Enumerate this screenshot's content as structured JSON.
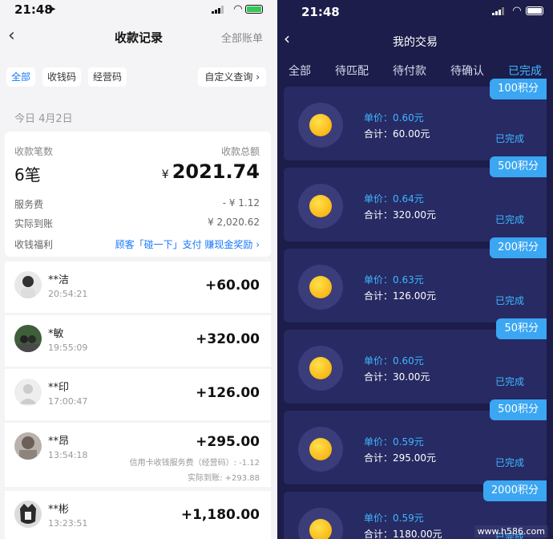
{
  "left": {
    "status": {
      "time": "21:48"
    },
    "nav": {
      "back": "‹",
      "title": "收款记录",
      "all_bills": "全部账单"
    },
    "filters": {
      "all": "全部",
      "qr_money": "收钱码",
      "business_code": "经营码",
      "custom": "自定义查询 ›"
    },
    "date": "今日 4月2日",
    "summary": {
      "count_label": "收款笔数",
      "total_label": "收款总额",
      "count_value": "6笔",
      "currency": "¥",
      "total_value": "2021.74",
      "service_fee_label": "服务费",
      "service_fee_value": "- ¥ 1.12",
      "actual_label": "实际到账",
      "actual_value": "¥ 2,020.62",
      "benefit_label": "收钱福利",
      "benefit_link": "顾客「碰一下」支付 赚现金奖励 ›"
    },
    "transactions": [
      {
        "name": "**洁",
        "time": "20:54:21",
        "amount": "+60.00"
      },
      {
        "name": "*敏",
        "time": "19:55:09",
        "amount": "+320.00"
      },
      {
        "name": "**印",
        "time": "17:00:47",
        "amount": "+126.00"
      },
      {
        "name": "**昂",
        "time": "13:54:18",
        "amount": "+295.00",
        "note1": "信用卡收钱服务费（经营码）: -1.12",
        "note2": "实际到账: +293.88"
      },
      {
        "name": "**彬",
        "time": "13:23:51",
        "amount": "+1,180.00"
      }
    ]
  },
  "right": {
    "status": {
      "time": "21:48"
    },
    "nav": {
      "back": "‹",
      "title": "我的交易"
    },
    "tabs": [
      "全部",
      "待匹配",
      "待付款",
      "待确认",
      "已完成"
    ],
    "active_tab": "已完成",
    "cards": [
      {
        "points": "100积分",
        "price": "单价：0.60元",
        "total": "合计：60.00元",
        "status": "已完成"
      },
      {
        "points": "500积分",
        "price": "单价：0.64元",
        "total": "合计：320.00元",
        "status": "已完成"
      },
      {
        "points": "200积分",
        "price": "单价：0.63元",
        "total": "合计：126.00元",
        "status": "已完成"
      },
      {
        "points": "50积分",
        "price": "单价：0.60元",
        "total": "合计：30.00元",
        "status": "已完成"
      },
      {
        "points": "500积分",
        "price": "单价：0.59元",
        "total": "合计：295.00元",
        "status": "已完成"
      },
      {
        "points": "2000积分",
        "price": "单价：0.59元",
        "total": "合计：1180.00元",
        "status": "已完成"
      }
    ],
    "watermark": "www.h586.com"
  },
  "colors": {
    "accent_blue": "#1677ff",
    "dark_bg": "#1c1d4a",
    "card_bg": "#272a63",
    "cyan": "#3fb8ff",
    "coin": "#f7a600"
  }
}
